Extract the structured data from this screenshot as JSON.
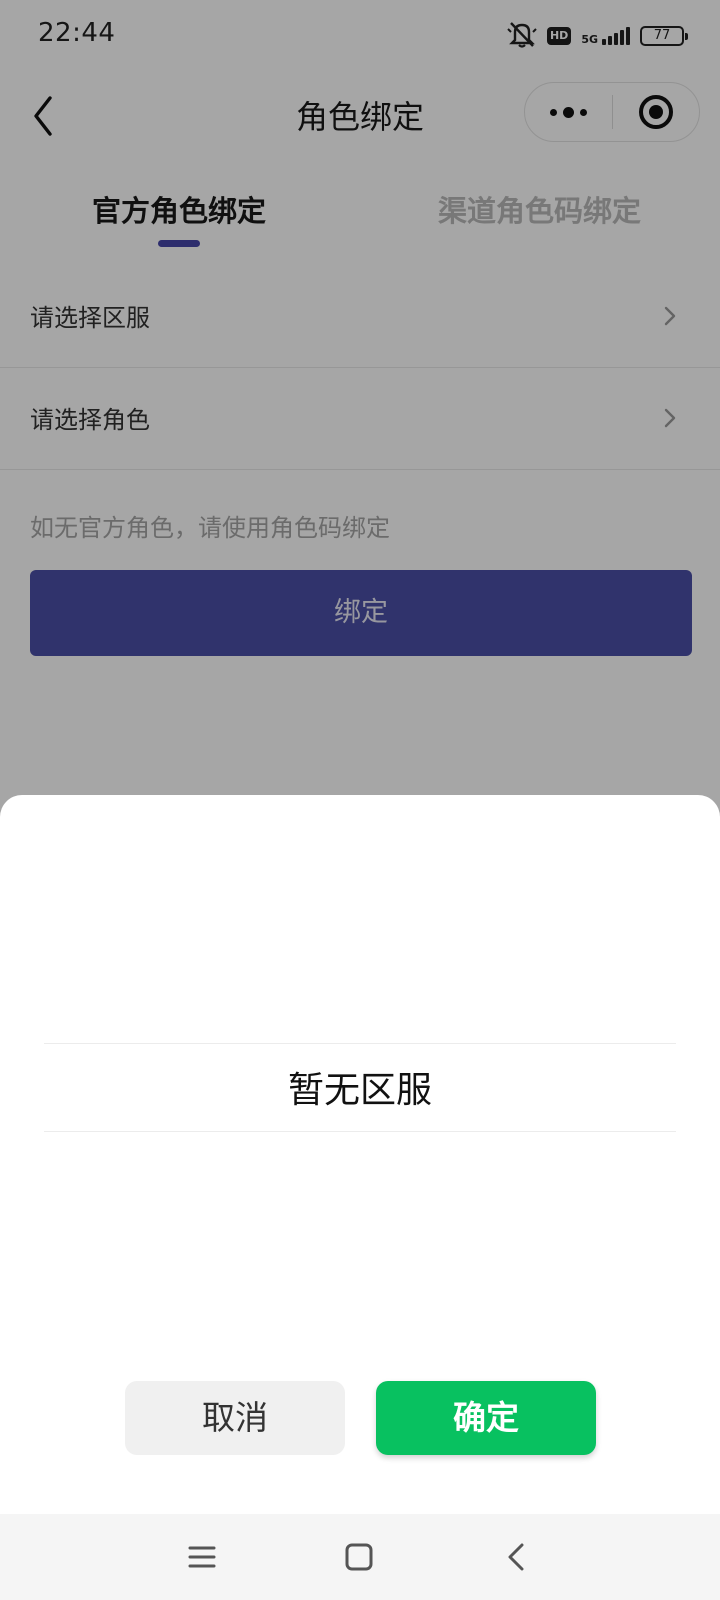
{
  "status_bar": {
    "time": "22:44",
    "network": "5G",
    "hd": "HD",
    "battery": "77",
    "icons": [
      "bell-muted-icon",
      "hd-icon",
      "signal-icon",
      "battery-icon"
    ]
  },
  "nav": {
    "title": "角色绑定",
    "icons": [
      "back-icon",
      "more-icon",
      "close-capsule-icon"
    ]
  },
  "tabs": [
    {
      "label": "官方角色绑定",
      "active": true
    },
    {
      "label": "渠道角色码绑定",
      "active": false
    }
  ],
  "form": {
    "server_placeholder": "请选择区服",
    "role_placeholder": "请选择角色",
    "hint": "如无官方角色，请使用角色码绑定",
    "bind_label": "绑定"
  },
  "picker": {
    "empty_text": "暂无区服",
    "cancel_label": "取消",
    "confirm_label": "确定"
  },
  "system_nav": {
    "icons": [
      "menu-icon",
      "home-icon",
      "back-icon"
    ]
  },
  "colors": {
    "accent": "#4b4fa6",
    "confirm": "#08c160",
    "tab_indicator": "#4545a8"
  }
}
